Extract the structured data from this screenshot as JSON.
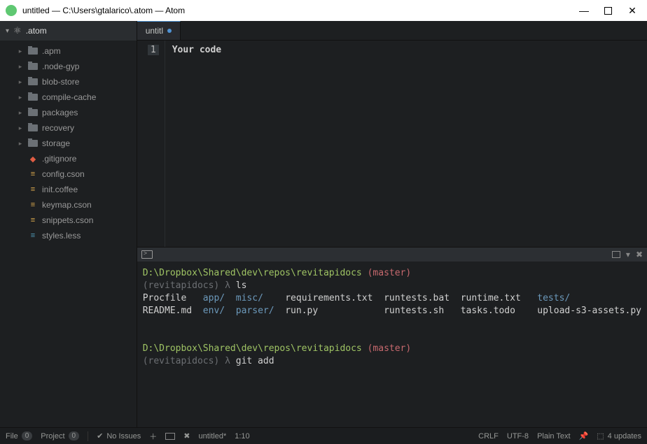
{
  "window": {
    "title": "untitled — C:\\Users\\gtalarico\\.atom — Atom"
  },
  "sidebar": {
    "root": ".atom",
    "folders": [
      ".apm",
      ".node-gyp",
      "blob-store",
      "compile-cache",
      "packages",
      "recovery",
      "storage"
    ],
    "files": [
      {
        "name": ".gitignore",
        "icon": "git"
      },
      {
        "name": "config.cson",
        "icon": "cson"
      },
      {
        "name": "init.coffee",
        "icon": "coffee"
      },
      {
        "name": "keymap.cson",
        "icon": "cson"
      },
      {
        "name": "snippets.cson",
        "icon": "cson"
      },
      {
        "name": "styles.less",
        "icon": "less"
      }
    ]
  },
  "tab": {
    "label": "untitl"
  },
  "editor": {
    "line1_no": "1",
    "line1_text": "Your code"
  },
  "terminal": {
    "path": "D:\\Dropbox\\Shared\\dev\\repos\\revitapidocs",
    "branch": "(master)",
    "env": "(revitapidocs)",
    "prompt": "λ",
    "cmd1": "ls",
    "row1_c0": "Procfile",
    "row1_c1": "app/",
    "row1_c2": "misc/",
    "row1_c3": "requirements.txt",
    "row1_c4": "runtests.bat",
    "row1_c5": "runtime.txt",
    "row1_c6": "tests/",
    "row2_c0": "README.md",
    "row2_c1": "env/",
    "row2_c2": "parser/",
    "row2_c3": "run.py",
    "row2_c4": "runtests.sh",
    "row2_c5": "tasks.todo",
    "row2_c6": "upload-s3-assets.py",
    "cmd2": "git add"
  },
  "status": {
    "file_lbl": "File",
    "file_n": "0",
    "proj_lbl": "Project",
    "proj_n": "0",
    "issues": "No Issues",
    "filename": "untitled*",
    "pos": "1:10",
    "eol": "CRLF",
    "enc": "UTF-8",
    "lang": "Plain Text",
    "updates": "4 updates"
  }
}
